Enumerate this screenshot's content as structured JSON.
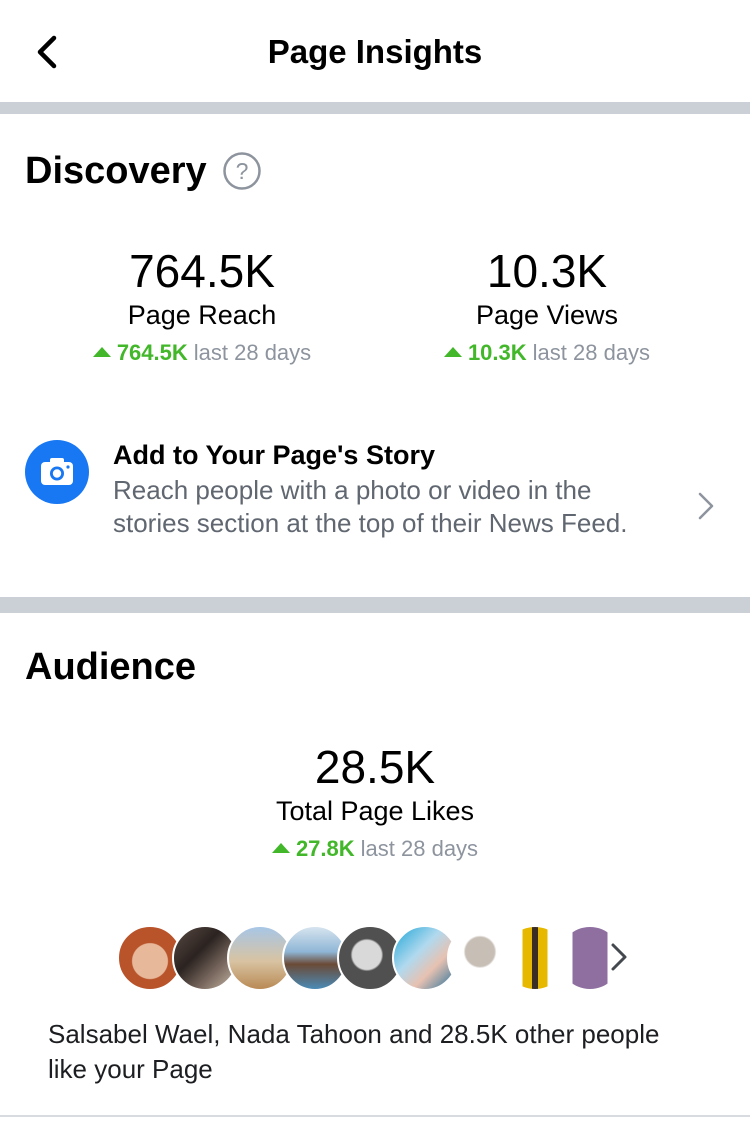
{
  "header": {
    "title": "Page Insights",
    "back_icon": "chevron-left-icon"
  },
  "discovery": {
    "title": "Discovery",
    "help_icon": "question-circle-icon",
    "metrics": [
      {
        "value": "764.5K",
        "label": "Page Reach",
        "delta": "764.5K",
        "period": "last 28 days"
      },
      {
        "value": "10.3K",
        "label": "Page Views",
        "delta": "10.3K",
        "period": "last 28 days"
      }
    ],
    "story": {
      "icon": "camera-icon",
      "title": "Add to Your Page's Story",
      "description": "Reach people with a photo or video in the stories section at the top of their News Feed."
    }
  },
  "audience": {
    "title": "Audience",
    "metric": {
      "value": "28.5K",
      "label": "Total Page Likes",
      "delta": "27.8K",
      "period": "last 28 days"
    },
    "liked_by": "Salsabel Wael, Nada Tahoon and 28.5K other people like your Page"
  },
  "colors": {
    "accent": "#1877f2",
    "positive": "#42b72a",
    "muted": "#8d949e",
    "separator": "#cbd0d6"
  }
}
